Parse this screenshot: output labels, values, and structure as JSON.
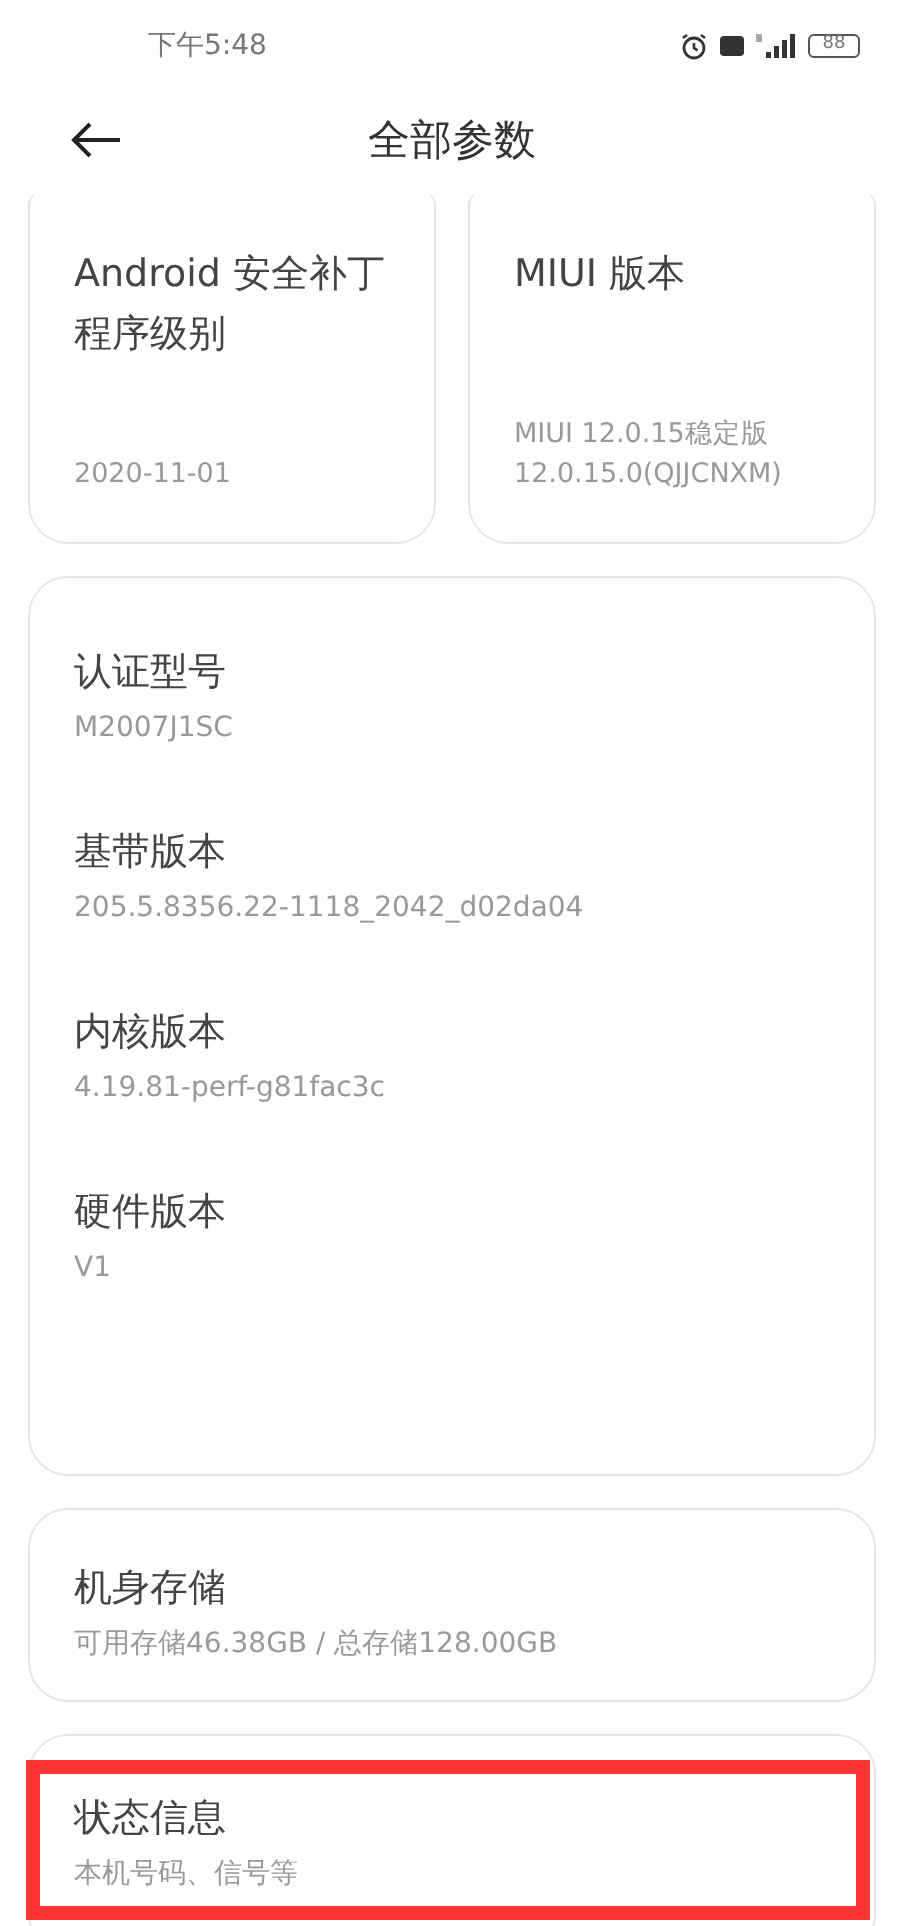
{
  "status_bar": {
    "time": "下午5:48",
    "battery": "88"
  },
  "header": {
    "title": "全部参数"
  },
  "top_cards": [
    {
      "title": "Android 安全补丁程序级别",
      "value": "2020-11-01"
    },
    {
      "title": "MIUI 版本",
      "value": "MIUI 12.0.15稳定版\n12.0.15.0(QJJCNXM)"
    }
  ],
  "info_items": [
    {
      "label": "认证型号",
      "value": "M2007J1SC"
    },
    {
      "label": "基带版本",
      "value": "205.5.8356.22-1118_2042_d02da04"
    },
    {
      "label": "内核版本",
      "value": "4.19.81-perf-g81fac3c"
    },
    {
      "label": "硬件版本",
      "value": "V1"
    }
  ],
  "storage": {
    "label": "机身存储",
    "value": "可用存储46.38GB / 总存储128.00GB"
  },
  "status_info": {
    "label": "状态信息",
    "value": "本机号码、信号等",
    "highlighted": true
  }
}
